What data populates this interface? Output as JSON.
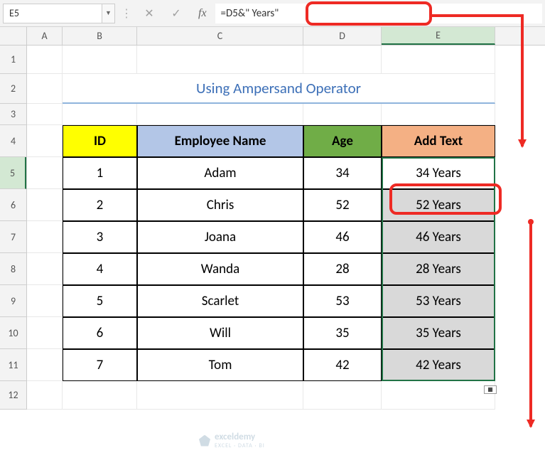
{
  "nameBox": "E5",
  "formula": "=D5&\" Years\"",
  "columns": [
    "A",
    "B",
    "C",
    "D",
    "E"
  ],
  "rowNumbers": [
    1,
    2,
    3,
    4,
    5,
    6,
    7,
    8,
    9,
    10,
    11,
    12
  ],
  "title": "Using Ampersand Operator",
  "headers": {
    "id": "ID",
    "name": "Employee Name",
    "age": "Age",
    "add": "Add Text"
  },
  "table": [
    {
      "id": "1",
      "name": "Adam",
      "age": "34",
      "add": "34 Years"
    },
    {
      "id": "2",
      "name": "Chris",
      "age": "52",
      "add": "52 Years"
    },
    {
      "id": "3",
      "name": "Joana",
      "age": "46",
      "add": "46 Years"
    },
    {
      "id": "4",
      "name": "Wanda",
      "age": "28",
      "add": "28 Years"
    },
    {
      "id": "5",
      "name": "Scarlet",
      "age": "53",
      "add": "53 Years"
    },
    {
      "id": "6",
      "name": "Will",
      "age": "35",
      "add": "35 Years"
    },
    {
      "id": "7",
      "name": "Tom",
      "age": "42",
      "add": "42 Years"
    }
  ],
  "watermark": "exceldemy",
  "watermarkSub": "EXCEL · DATA · BI"
}
